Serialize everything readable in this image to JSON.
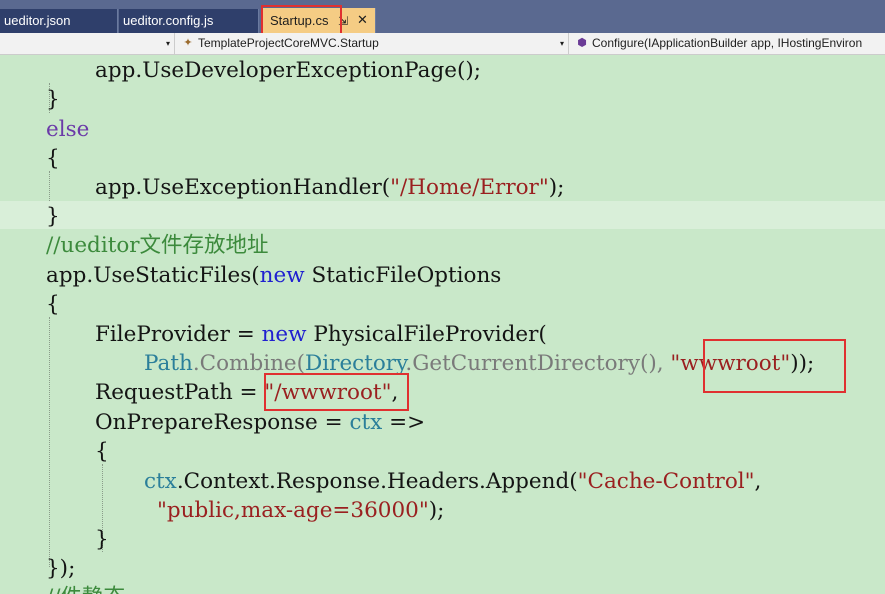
{
  "tabs": [
    {
      "label": "ueditor.json"
    },
    {
      "label": "ueditor.config.js"
    },
    {
      "label": "Startup.cs",
      "active": true
    }
  ],
  "tab_pin_glyph": "⇲",
  "tab_close_glyph": "✕",
  "navbar": {
    "project_dropdown": "",
    "class_dropdown": "TemplateProjectCoreMVC.Startup",
    "member_dropdown": "Configure(IApplicationBuilder app, IHostingEnviron",
    "class_icon": "class-icon",
    "member_icon": "method-icon",
    "dropdown_arrow": "▾"
  },
  "code": {
    "l1": {
      "a": "app",
      "b": ".UseDeveloperExceptionPage();"
    },
    "l2": "}",
    "l3": "else",
    "l4": "{",
    "l5": {
      "a": "app",
      "b": ".UseExceptionHandler(",
      "s": "\"/Home/Error\"",
      "c": ");"
    },
    "l6": "}",
    "l7": "//ueditor文件存放地址",
    "l8": {
      "a": "app",
      "b": ".UseStaticFiles(",
      "k": "new",
      "c": " StaticFileOptions"
    },
    "l9": "{",
    "l10": {
      "a": "FileProvider = ",
      "k": "new",
      "c": " PhysicalFileProvider("
    },
    "l11": {
      "t1": "Path",
      "p1": ".",
      "m1": "Combine(",
      "t2": "Directory",
      "p2": ".",
      "m2": "GetCurrentDirectory(), ",
      "s": "\"wwwroot\"",
      "c": "));"
    },
    "l12": {
      "a": "RequestPath = ",
      "s": "\"/wwwroot\"",
      "c": ","
    },
    "l13": {
      "a": "OnPrepareResponse = ",
      "k": "ctx",
      "c": " =>"
    },
    "l14": "{",
    "l15": {
      "k": "ctx",
      "a": ".Context.Response.Headers.Append(",
      "s": "\"Cache-Control\"",
      "c": ","
    },
    "l16": {
      "s": "\"public,max-age=36000\"",
      "c": ");"
    },
    "l17": "}",
    "l18": "});",
    "l19": "//件静态"
  },
  "colors": {
    "editor_bg": "#c9e8c9",
    "keyword": "#2020d0",
    "string": "#9a2020",
    "comment": "#3c8a3c",
    "type": "#2b7f9a",
    "annotation": "#e03030",
    "active_tab": "#f5cc84"
  }
}
